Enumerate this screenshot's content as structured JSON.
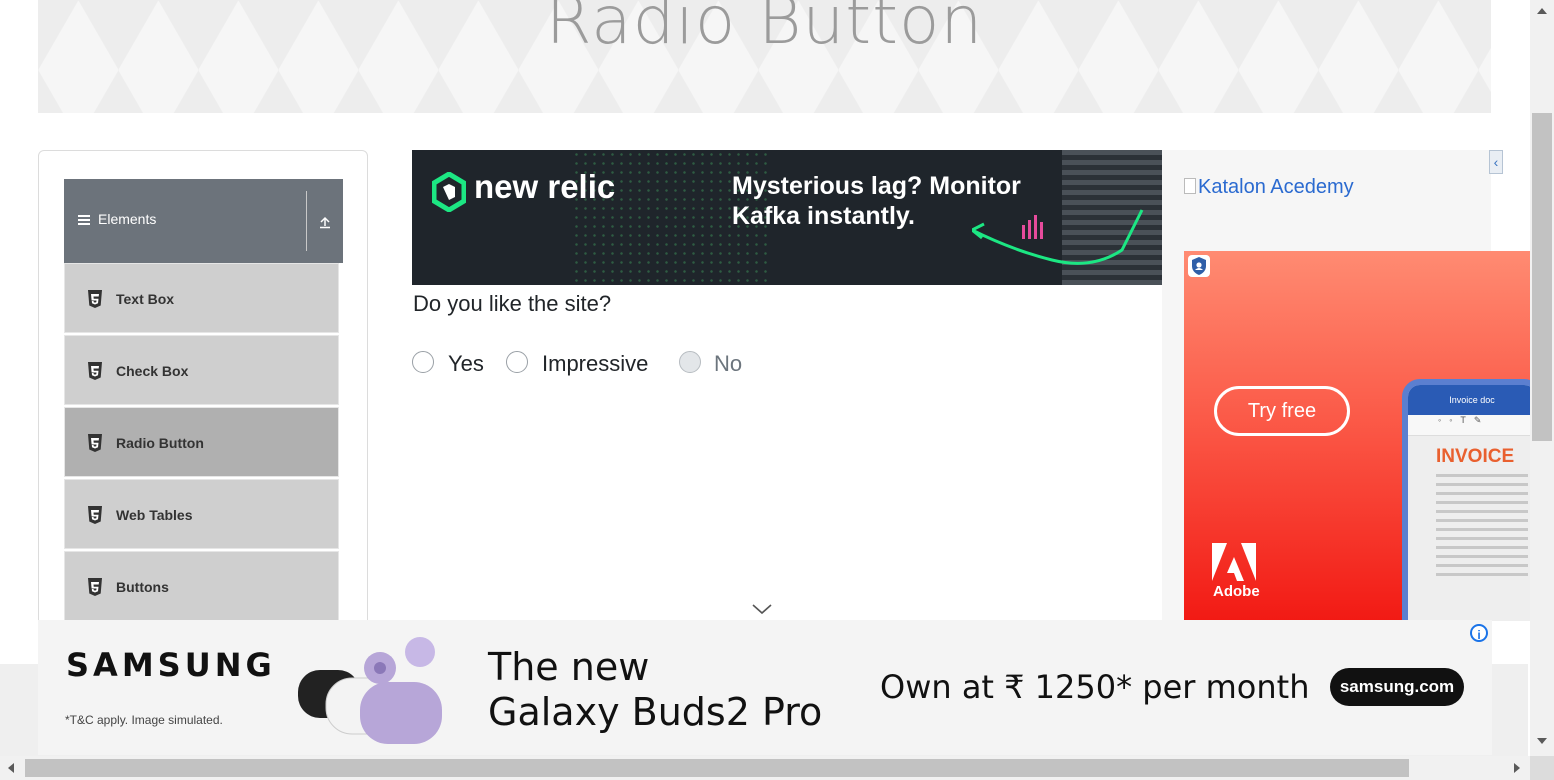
{
  "page": {
    "title": "Radio Button"
  },
  "sidebar": {
    "group": {
      "label": "Elements",
      "icon": "hamburger-icon",
      "collapse_icon": "collapse-up-icon"
    },
    "items": [
      {
        "label": "Text Box",
        "icon": "html5-icon",
        "active": false
      },
      {
        "label": "Check Box",
        "icon": "html5-icon",
        "active": false
      },
      {
        "label": "Radio Button",
        "icon": "html5-icon",
        "active": true
      },
      {
        "label": "Web Tables",
        "icon": "html5-icon",
        "active": false
      },
      {
        "label": "Buttons",
        "icon": "html5-icon",
        "active": false
      }
    ]
  },
  "main": {
    "question": "Do you like the site?",
    "options": [
      {
        "label": "Yes",
        "checked": false,
        "disabled": false
      },
      {
        "label": "Impressive",
        "checked": false,
        "disabled": false
      },
      {
        "label": "No",
        "checked": false,
        "disabled": true
      }
    ]
  },
  "ads": {
    "top": {
      "brand": "new relic",
      "line1": "Mysterious lag? Monitor",
      "line2": "Kafka instantly.",
      "accent": "#1ce783"
    },
    "side": {
      "close_label": "‹",
      "image_alt": "Katalon Acedemy",
      "adobe": {
        "button": "Try free",
        "brand": "Adobe",
        "doc_header": "Invoice doc",
        "doc_title": "INVOICE"
      }
    },
    "bottom": {
      "brand": "SAMSUNG",
      "note": "*T&C apply. Image simulated.",
      "title_line1": "The new",
      "title_line2": "Galaxy Buds2 Pro",
      "offer": "Own at ₹ 1250* per month",
      "cta": "samsung.com",
      "info_icon": "i"
    }
  }
}
